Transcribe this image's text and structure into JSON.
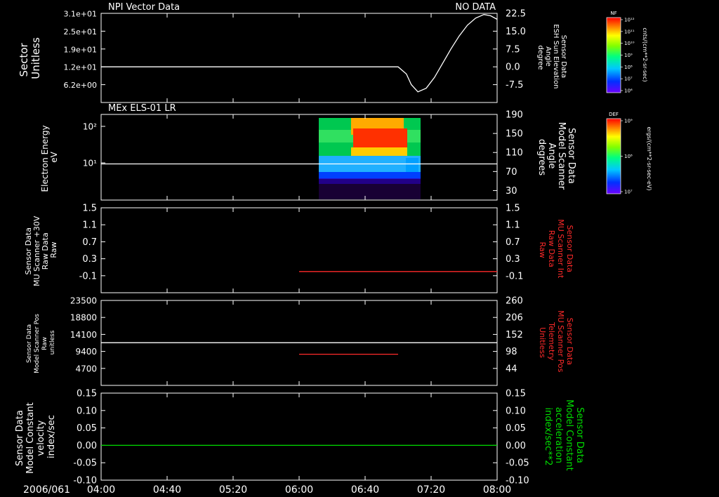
{
  "date_label": "2006/061",
  "time_labels": [
    "04:00",
    "04:40",
    "05:20",
    "06:00",
    "06:40",
    "07:20",
    "08:00"
  ],
  "chart_data": [
    {
      "id": "p1",
      "type": "line",
      "title": "NPI Vector Data",
      "status": "NO DATA",
      "ylabel_left": [
        "Sector",
        "Unitless"
      ],
      "ylabel_right": [
        "Sensor Data",
        "ESH Sun Elevation",
        "Angle",
        "degree"
      ],
      "left_ticks": [
        "3.1e+01",
        "2.5e+01",
        "1.9e+01",
        "1.2e+01",
        "6.2e+00"
      ],
      "right_ticks": [
        "22.5",
        "15.0",
        "7.5",
        "0.0",
        "-7.5"
      ],
      "right_ylim": [
        -15,
        22.5
      ],
      "series": [
        {
          "color": "#ffffff",
          "x": [
            "04:00",
            "06:25",
            "07:00",
            "07:05",
            "07:08",
            "07:12",
            "07:17",
            "07:22",
            "07:27",
            "07:32",
            "07:37",
            "07:42",
            "07:47",
            "07:52",
            "07:56",
            "08:00"
          ],
          "y": [
            0,
            0,
            0,
            -3,
            -7.5,
            -10.5,
            -9,
            -4.5,
            1.5,
            7.5,
            13,
            17.5,
            20.5,
            22,
            21.5,
            20
          ]
        }
      ]
    },
    {
      "id": "p2",
      "type": "heatmap",
      "title": "MEx ELS-01 LR",
      "ylabel_left": [
        "Electron Energy",
        "eV"
      ],
      "ylabel_right": [
        "Sensor Data",
        "Model Scanner",
        "Angle",
        "degrees"
      ],
      "left_ticks": [
        "10²",
        "10¹"
      ],
      "right_ticks": [
        "190",
        "150",
        "110",
        "70",
        "30"
      ],
      "right_ylim": [
        10,
        190
      ],
      "xrange": [
        "06:05",
        "07:07"
      ],
      "series": [
        {
          "color": "#ffffff",
          "x": [
            "04:00",
            "08:00"
          ],
          "y": [
            86,
            86
          ]
        }
      ]
    },
    {
      "id": "p3",
      "type": "line",
      "ylabel_left": [
        "Sensor Data",
        "MU Scanner +30V",
        "Raw Data",
        "Raw"
      ],
      "ylabel_right": [
        "Sensor Data",
        "MU Scanner Int",
        "Raw Data",
        "Raw"
      ],
      "left_ticks": [
        "1.5",
        "1.1",
        "0.7",
        "0.3",
        "-0.1"
      ],
      "right_ticks": [
        "1.5",
        "1.1",
        "0.7",
        "0.3",
        "-0.1"
      ],
      "right_ylim": [
        -0.5,
        1.5
      ],
      "series": [
        {
          "color": "#ff2a2a",
          "x": [
            "06:00",
            "08:00"
          ],
          "y": [
            0.0,
            0.0
          ]
        }
      ]
    },
    {
      "id": "p4",
      "type": "line",
      "ylabel_left": [
        "Sensor Data",
        "Model Scanner Pos",
        "Raw",
        "unitless"
      ],
      "ylabel_right": [
        "Sensor Data",
        "MU Scanner Pos",
        "Telemetry",
        "Unitless"
      ],
      "left_ticks": [
        "23500",
        "18800",
        "14100",
        "9400",
        "4700"
      ],
      "left_ylim": [
        0,
        23500
      ],
      "right_ticks": [
        "260",
        "206",
        "152",
        "98",
        "44"
      ],
      "right_ylim": [
        -10,
        260
      ],
      "series": [
        {
          "color": "#ffffff",
          "axis": "left",
          "x": [
            "04:00",
            "08:00"
          ],
          "y": [
            11800,
            11800
          ]
        },
        {
          "color": "#ff2a2a",
          "axis": "right",
          "x": [
            "06:00",
            "07:00"
          ],
          "y": [
            89,
            89
          ]
        }
      ]
    },
    {
      "id": "p5",
      "type": "line",
      "ylabel_left": [
        "Sensor Data",
        "Model Constant",
        "velocity",
        "index/sec"
      ],
      "ylabel_right": [
        "Sensor Data",
        "Model Constant",
        "acceleration",
        "index/sec**2"
      ],
      "left_ticks": [
        "0.15",
        "0.10",
        "0.05",
        "0.00",
        "-0.05",
        "-0.10"
      ],
      "right_ticks": [
        "0.15",
        "0.10",
        "0.05",
        "0.00",
        "-0.05",
        "-0.10"
      ],
      "right_ylim": [
        -0.1,
        0.15
      ],
      "series": [
        {
          "color": "#00dd00",
          "x": [
            "04:00",
            "08:00"
          ],
          "y": [
            0.0,
            0.0
          ]
        }
      ]
    }
  ],
  "colorbars": [
    {
      "label": "NF",
      "ticks": [
        "10¹²",
        "10¹¹",
        "10¹⁰",
        "10⁹",
        "10⁸",
        "10⁷",
        "10⁶"
      ],
      "units": "cnts/(cm**2-sr-sec)"
    },
    {
      "label": "DEF",
      "ticks": [
        "10⁹",
        "10⁸",
        "10⁷"
      ],
      "units": "ergs/(cm**2-sr-sec-eV)"
    }
  ]
}
